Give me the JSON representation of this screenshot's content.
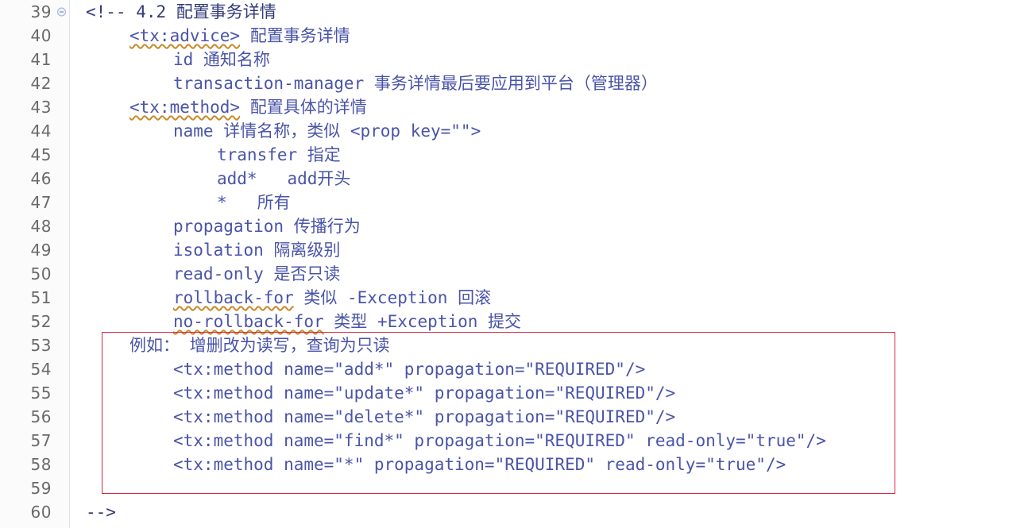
{
  "editor": {
    "background_color": "#ffffff",
    "gutter_color": "#fbfbfb",
    "text_color": "#4a54a8",
    "comment_color": "#333b77",
    "annotation_color": "#d6283c",
    "squiggle_color": "#c98b2e"
  },
  "gutter": {
    "line_numbers": [
      "39",
      "40",
      "41",
      "42",
      "43",
      "44",
      "45",
      "46",
      "47",
      "48",
      "49",
      "50",
      "51",
      "52",
      "53",
      "54",
      "55",
      "56",
      "57",
      "58",
      "59",
      "60"
    ],
    "fold_marker_line": "39",
    "fold_marker_icon": "collapse-minus-circle-icon"
  },
  "lines": [
    {
      "number": "39",
      "indent": 0,
      "text": "<!-- 4.2 配置事务详情",
      "style": "navy",
      "squiggle": false
    },
    {
      "number": "40",
      "indent": 1,
      "tag": "<tx:advice>",
      "rest": " 配置事务详情",
      "style": "blue",
      "squiggle": true
    },
    {
      "number": "41",
      "indent": 2,
      "text": "id 通知名称",
      "style": "blue",
      "squiggle": false
    },
    {
      "number": "42",
      "indent": 2,
      "text": "transaction-manager 事务详情最后要应用到平台（管理器）",
      "style": "blue",
      "squiggle": false
    },
    {
      "number": "43",
      "indent": 1,
      "tag": "<tx:method>",
      "rest": " 配置具体的详情",
      "style": "blue",
      "squiggle": true
    },
    {
      "number": "44",
      "indent": 2,
      "text": "name 详情名称，类似 <prop key=\"\">",
      "style": "blue",
      "squiggle": false
    },
    {
      "number": "45",
      "indent": 3,
      "text": "transfer 指定",
      "style": "blue",
      "squiggle": false
    },
    {
      "number": "46",
      "indent": 3,
      "text": "add*   add开头",
      "style": "blue",
      "squiggle": false
    },
    {
      "number": "47",
      "indent": 3,
      "text": "*   所有",
      "style": "blue",
      "squiggle": false
    },
    {
      "number": "48",
      "indent": 2,
      "text": "propagation 传播行为",
      "style": "blue",
      "squiggle": false
    },
    {
      "number": "49",
      "indent": 2,
      "text": "isolation 隔离级别",
      "style": "blue",
      "squiggle": false
    },
    {
      "number": "50",
      "indent": 2,
      "text": "read-only 是否只读",
      "style": "blue",
      "squiggle": false
    },
    {
      "number": "51",
      "indent": 2,
      "tag": "rollback-for",
      "rest": " 类似 -Exception 回滚",
      "style": "blue",
      "squiggle": true
    },
    {
      "number": "52",
      "indent": 2,
      "tag": "no-rollback-for",
      "rest": " 类型 +Exception 提交",
      "style": "blue",
      "squiggle": true
    },
    {
      "number": "53",
      "indent": 1,
      "text": "例如： 增删改为读写，查询为只读",
      "style": "blue",
      "squiggle": false
    },
    {
      "number": "54",
      "indent": 2,
      "text": "<tx:method name=\"add*\" propagation=\"REQUIRED\"/>",
      "style": "blue",
      "squiggle": false
    },
    {
      "number": "55",
      "indent": 2,
      "text": "<tx:method name=\"update*\" propagation=\"REQUIRED\"/>",
      "style": "blue",
      "squiggle": false
    },
    {
      "number": "56",
      "indent": 2,
      "text": "<tx:method name=\"delete*\" propagation=\"REQUIRED\"/>",
      "style": "blue",
      "squiggle": false
    },
    {
      "number": "57",
      "indent": 2,
      "text": "<tx:method name=\"find*\" propagation=\"REQUIRED\" read-only=\"true\"/>",
      "style": "blue",
      "squiggle": false
    },
    {
      "number": "58",
      "indent": 2,
      "text": "<tx:method name=\"*\" propagation=\"REQUIRED\" read-only=\"true\"/>",
      "style": "blue",
      "squiggle": false
    },
    {
      "number": "59",
      "indent": 0,
      "text": "",
      "style": "blue",
      "squiggle": false
    },
    {
      "number": "60",
      "indent": 0,
      "text": "-->",
      "style": "navy",
      "squiggle": false
    }
  ],
  "annotation": {
    "name": "red-highlight-rectangle",
    "covers_lines": [
      "53",
      "54",
      "55",
      "56",
      "57",
      "58",
      "59"
    ],
    "color": "#d6283c"
  }
}
